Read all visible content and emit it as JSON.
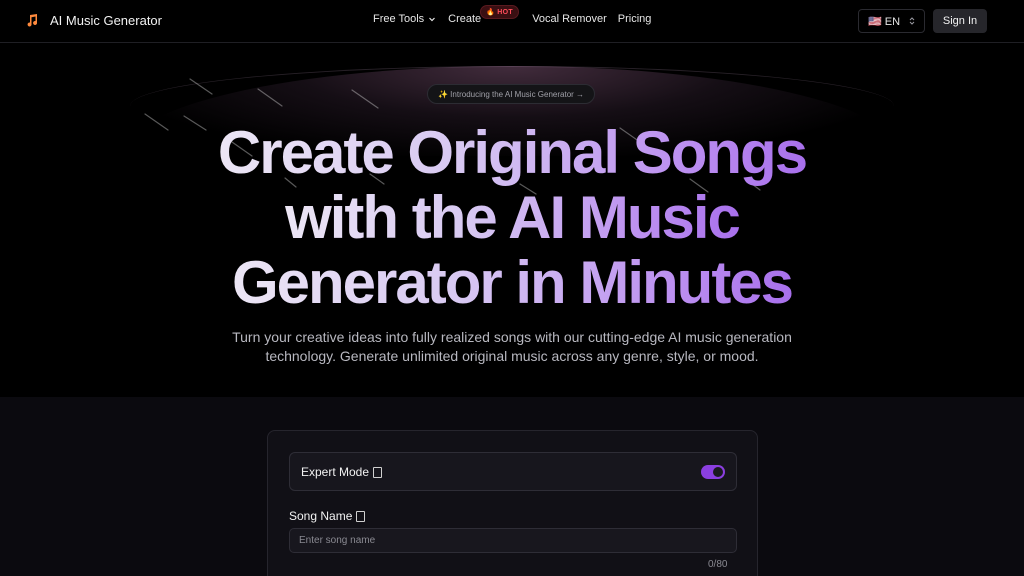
{
  "header": {
    "brand_name": "AI Music Generator",
    "nav": [
      {
        "label": "Free Tools",
        "has_dropdown": true
      },
      {
        "label": "Create",
        "badge": "🔥 HOT"
      },
      {
        "label": "Vocal Remover"
      },
      {
        "label": "Pricing"
      }
    ],
    "language": "🇺🇸 EN",
    "signin_label": "Sign In"
  },
  "hero": {
    "intro_pill": "✨ Introducing the AI Music Generator →",
    "headline_lines": [
      "Create Original Songs",
      "with the AI Music",
      "Generator in Minutes"
    ],
    "subtitle": "Turn your creative ideas into fully realized songs with our cutting-edge AI music generation technology. Generate unlimited original music across any genre, style, or mood."
  },
  "form": {
    "expert_mode_label": "Expert Mode",
    "expert_mode_on": true,
    "song_name_label": "Song Name",
    "song_name_placeholder": "Enter song name",
    "song_name_value": "",
    "song_name_counter": "0/80"
  },
  "colors": {
    "accent": "#8b3fe0",
    "hot_badge": "#ff4d5a",
    "brand_icon": "#ff8a3d"
  },
  "icons": {
    "brand": "music-note-icon",
    "dropdown": "chevron-down-icon",
    "language_select": "chevron-up-down-icon",
    "info": "info-icon"
  }
}
